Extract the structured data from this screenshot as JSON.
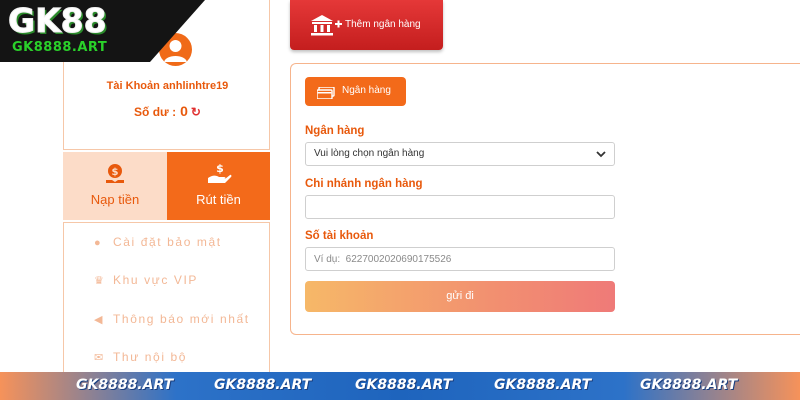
{
  "logo": {
    "brand": "GK88",
    "domain": "GK8888.ART"
  },
  "account": {
    "name": "Tài Khoản anhlinhtre19",
    "balance_label": "Số dư :",
    "balance_value": "0"
  },
  "tabs": [
    {
      "label": "Nạp tiền",
      "icon": "coin-bag-icon",
      "active": false
    },
    {
      "label": "Rút tiền",
      "icon": "hand-money-icon",
      "active": true
    }
  ],
  "menu": [
    {
      "label": "Cài đặt bảo mật",
      "icon": "user-lock-icon"
    },
    {
      "label": "Khu vực VIP",
      "icon": "crown-icon"
    },
    {
      "label": "Thông báo mới nhất",
      "icon": "megaphone-icon"
    },
    {
      "label": "Thư nội bộ",
      "icon": "envelope-icon"
    }
  ],
  "add_bank_button": {
    "label": "Thêm ngân hàng",
    "icon": "bank-add-icon"
  },
  "form": {
    "tab_label": "Ngân hàng",
    "bank": {
      "label": "Ngân hàng",
      "value": "Vui lòng chọn ngân hàng"
    },
    "branch": {
      "label": "Chi nhánh ngân hàng",
      "value": "",
      "placeholder": ""
    },
    "account_number": {
      "label": "Số tài khoản",
      "value": "",
      "placeholder": "Ví dụ:  6227002020690175526"
    },
    "submit_label": "gửi đi"
  },
  "banner": {
    "items": [
      "GK8888.ART",
      "GK8888.ART",
      "GK8888.ART",
      "GK8888.ART",
      "GK8888.ART"
    ]
  },
  "colors": {
    "accent": "#f36a1a",
    "label": "#e8590c",
    "danger": "#d52b2b",
    "banner": "#1e64bd"
  }
}
